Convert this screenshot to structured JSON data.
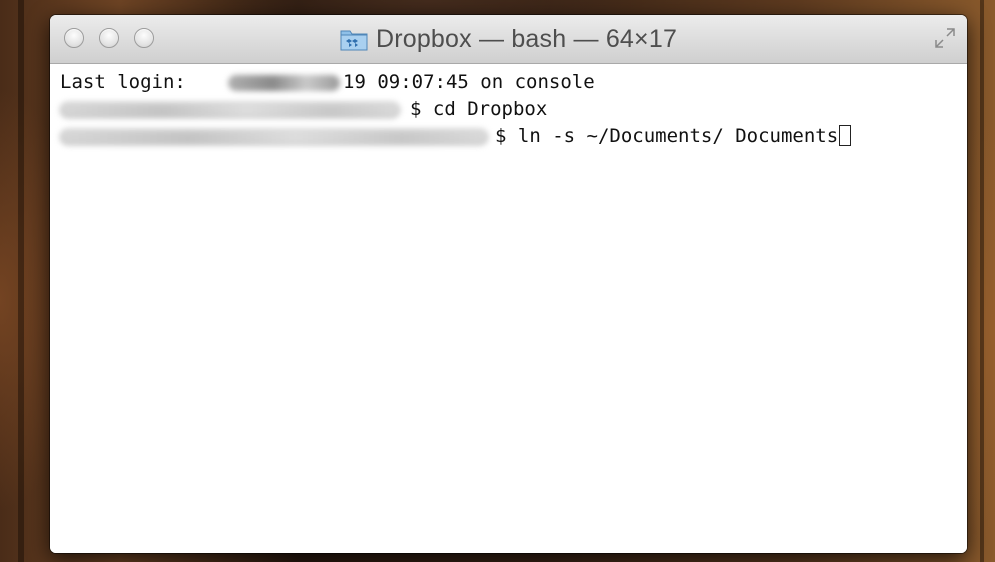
{
  "window": {
    "title": "Dropbox — bash — 64×17",
    "title_icon": "dropbox-folder-icon",
    "controls": [
      "close-button",
      "minimize-button",
      "zoom-button"
    ],
    "fullscreen_icon": "fullscreen-arrows-icon"
  },
  "terminal": {
    "lines": [
      {
        "prefix": "Last login: ",
        "redacted": true,
        "suffix": "19 09:07:45 on console"
      },
      {
        "redacted": true,
        "suffix": "$ cd Dropbox"
      },
      {
        "redacted": true,
        "suffix": "$ ln -s ~/Documents/ Documents"
      }
    ],
    "cursor": "block-outline"
  },
  "colors": {
    "terminal_bg": "#ffffff",
    "terminal_text": "#111111",
    "titlebar_text": "#4e4e4e"
  }
}
